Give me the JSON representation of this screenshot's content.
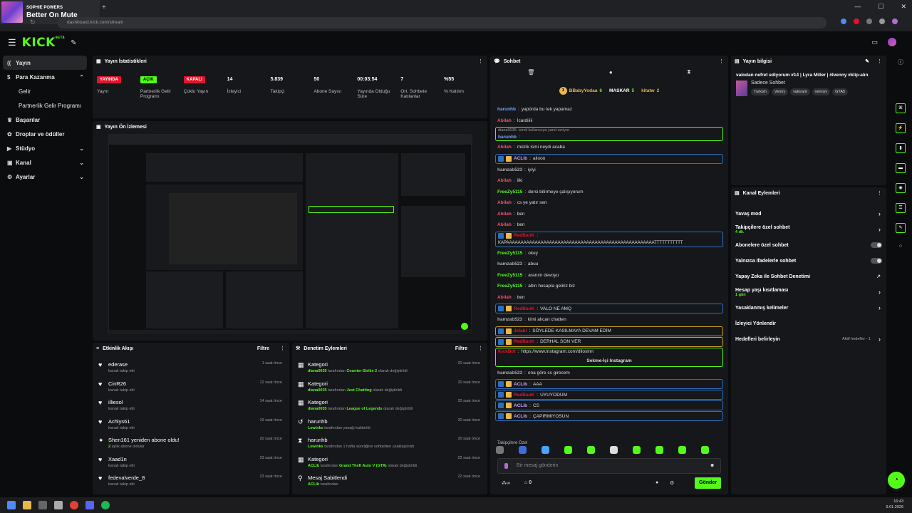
{
  "media": {
    "artist": "SOPHIE POWERS",
    "title": "Better On Mute"
  },
  "browser": {
    "url": "dashboard.kick.com/stream",
    "new_tab": "+"
  },
  "app": {
    "logo": "KICK",
    "logo_tag": "BETA"
  },
  "sidebar": {
    "items": [
      {
        "label": "Yayın",
        "icon": "broadcast-icon",
        "active": true
      },
      {
        "label": "Para Kazanma",
        "icon": "money-icon",
        "expand": "up"
      },
      {
        "label": "Gelir",
        "sub": true
      },
      {
        "label": "Partnerlik Gelir Programı",
        "sub": true
      },
      {
        "label": "Başarılar",
        "icon": "trophy-icon"
      },
      {
        "label": "Droplar ve ödüller",
        "icon": "gift-icon"
      },
      {
        "label": "Stüdyo",
        "icon": "studio-icon",
        "expand": "down"
      },
      {
        "label": "Kanal",
        "icon": "channel-icon",
        "expand": "down"
      },
      {
        "label": "Ayarlar",
        "icon": "gear-icon",
        "expand": "down"
      }
    ]
  },
  "stats": {
    "title": "Yayın İstatistikleri",
    "items": [
      {
        "value": "YAYINDA",
        "label": "Yayın",
        "badge": "red"
      },
      {
        "value": "AÇIK",
        "label": "Partnerlik Gelir Programı",
        "badge": "green"
      },
      {
        "value": "KAPALI",
        "label": "Çoklu Yayın",
        "badge": "red"
      },
      {
        "value": "14",
        "label": "İzleyici"
      },
      {
        "value": "5.839",
        "label": "Takipçi"
      },
      {
        "value": "50",
        "label": "Abone Sayısı"
      },
      {
        "value": "00:03:54",
        "label": "Yayında Olduğu Süre"
      },
      {
        "value": "7",
        "label": "Ort. Sohbete Katılanlar"
      },
      {
        "value": "%55",
        "label": "% Katılım"
      }
    ]
  },
  "preview": {
    "title": "Yayın Ön İzlemesi"
  },
  "activity": {
    "title": "Etkinlik Akışı",
    "filter": "Filtre",
    "items": [
      {
        "name": "ederase",
        "sub": "kanalı takip etti",
        "time": "1 saat önce",
        "icon": "heart-icon"
      },
      {
        "name": "CinR26",
        "sub": "kanalı takip etti",
        "time": "12 saat önce",
        "icon": "heart-icon"
      },
      {
        "name": "illiesol",
        "sub": "kanalı takip etti",
        "time": "14 saat önce",
        "icon": "heart-icon"
      },
      {
        "name": "Achlys61",
        "sub": "kanalı takip etti",
        "time": "19 saat önce",
        "icon": "heart-icon"
      },
      {
        "name": "Shen161 yeniden abone oldu!",
        "sub_highlight": "2",
        "sub": " aylık abone oldular",
        "time": "20 saat önce",
        "icon": "star-icon"
      },
      {
        "name": "Xaad1n",
        "sub": "kanalı takip etti",
        "time": "23 saat önce",
        "icon": "heart-icon"
      },
      {
        "name": "fedevalverde_8",
        "sub": "kanalı takip etti",
        "time": "23 saat önce",
        "icon": "heart-icon"
      }
    ]
  },
  "moderation": {
    "title": "Denetim Eylemleri",
    "filter": "Filtre",
    "items": [
      {
        "name": "Kategori",
        "user": "diana0035",
        "mid": " tarafından ",
        "target": "Counter-Strike 2",
        "rest": " olarak değiştirildi",
        "time": "20 saat önce",
        "icon": "category-icon"
      },
      {
        "name": "Kategori",
        "user": "diana0035",
        "mid": " tarafından ",
        "target": "Just Chatting",
        "rest": " olarak değiştirildi",
        "time": "20 saat önce",
        "icon": "category-icon"
      },
      {
        "name": "Kategori",
        "user": "diana0035",
        "mid": " tarafından ",
        "target": "League of Legends",
        "rest": " olarak değiştirildi",
        "time": "20 saat önce",
        "icon": "category-icon"
      },
      {
        "name": "harunhb",
        "user": "Lewinks",
        "mid": " tarafından yasağı kaldırıldı",
        "target": "",
        "rest": "",
        "time": "20 saat önce",
        "icon": "undo-icon"
      },
      {
        "name": "harunhb",
        "user": "Lewinks",
        "mid": " tarafından 1 hafta süreliğine sohbetten uzaklaştırıldı",
        "target": "",
        "rest": "",
        "time": "20 saat önce",
        "icon": "timeout-icon"
      },
      {
        "name": "Kategori",
        "user": "ACLib",
        "mid": " tarafından ",
        "target": "Grand Theft Auto V (GTA)",
        "rest": " olarak değiştirildi",
        "time": "22 saat önce",
        "icon": "category-icon"
      },
      {
        "name": "Mesaj Sabitlendi",
        "user": "ACLib",
        "mid": " tarafından",
        "target": "",
        "rest": "",
        "time": "22 saat önce",
        "icon": "pin-icon"
      }
    ]
  },
  "chat": {
    "title": "Sohbet",
    "leader": [
      {
        "rank": "1",
        "name": "BBabyYodaa",
        "count": "6"
      },
      {
        "name": "MASKAR",
        "count": "5"
      },
      {
        "name": "kitatw",
        "count": "2"
      }
    ],
    "messages": [
      {
        "user": "harunhb",
        "color": "#6fa8ff",
        "text": "yapürda bu tek yapamaz"
      },
      {
        "user": "Abilah",
        "color": "#ff4d6d",
        "text": "İcardiiiii"
      },
      {
        "user": "harunhb",
        "color": "#6fa8ff",
        "text": "",
        "reply": "diana0035:  isimli kullanıcıya yanıt veriyor",
        "hl": "green"
      },
      {
        "user": "Abilah",
        "color": "#ff4d6d",
        "text": "müzik ismi neydi acaba"
      },
      {
        "user": "ACLib",
        "color": "#c6a0ff",
        "text": "aliooo",
        "hl": "blue"
      },
      {
        "user": "hamzab523",
        "color": "#aaa",
        "text": "iyiyi"
      },
      {
        "user": "Abilah",
        "color": "#ff4d6d",
        "text": "iiki"
      },
      {
        "user": "FreeZy5115",
        "color": "#53fc18",
        "text": "dersi bitirmeye çalışıyorum"
      },
      {
        "user": "Abilah",
        "color": "#ff4d6d",
        "text": "cs ye yatır sen"
      },
      {
        "user": "Abilah",
        "color": "#ff4d6d",
        "text": "ben"
      },
      {
        "user": "Abilah",
        "color": "#ff4d6d",
        "text": "ben"
      },
      {
        "user": "RedBanK",
        "color": "#e0142b",
        "text": "KAPAAAAAAAAAAAAAAAAAAAAAAAAAAAAAAAAAAAAAAAAAAAAAAAAAAAATTTTTTTTTTT",
        "hl": "blue",
        "tall": true
      },
      {
        "user": "FreeZy5115",
        "color": "#53fc18",
        "text": "okey"
      },
      {
        "user": "hamzab523",
        "color": "#aaa",
        "text": "abuu"
      },
      {
        "user": "FreeZy5115",
        "color": "#53fc18",
        "text": "aranım devoyu"
      },
      {
        "user": "FreeZy5115",
        "color": "#53fc18",
        "text": "altın hesapla geliriz biz"
      },
      {
        "user": "Abilah",
        "color": "#ff4d6d",
        "text": "ben"
      },
      {
        "user": "RedBanK",
        "color": "#e0142b",
        "text": "VALO NE AMQ",
        "hl": "blue"
      },
      {
        "user": "hamzab523",
        "color": "#aaa",
        "text": "kimi alıcan chatten"
      },
      {
        "user": "Jelabi",
        "color": "#e0142b",
        "text": "SÖYLEDE KASILMAYA DEVAM EDİM",
        "hl": "gold"
      },
      {
        "user": "RedBanK",
        "color": "#e0142b",
        "text": "DERHAL SON VER",
        "hl": "gold"
      },
      {
        "user": "KickBot",
        "color": "#e0142b",
        "text": "https://www.instagram.com/dilosinn",
        "hl": "green",
        "button": "Sekme-İçi Instagram"
      },
      {
        "user": "hamzab523",
        "color": "#aaa",
        "text": "ona göre cs girecem"
      },
      {
        "user": "ACLib",
        "color": "#c6a0ff",
        "text": "AAA",
        "hl": "blue"
      },
      {
        "user": "RedBanK",
        "color": "#e0142b",
        "text": "UYUYODUM",
        "hl": "blue"
      },
      {
        "user": "ACLib",
        "color": "#c6a0ff",
        "text": "CS",
        "hl": "blue"
      },
      {
        "user": "ACLib",
        "color": "#c6a0ff",
        "text": "ÇAPIRMIYOSUN",
        "hl": "blue"
      }
    ],
    "followers_only": "Takipçilere Özel",
    "placeholder": "Bir mesaj gönderin",
    "send": "Gönder",
    "count": "0"
  },
  "info": {
    "title": "Yayın bilgisi",
    "stream_title": "valodan nefret ediyorum #14 | Lyra Miller | #Ivenny #klip-alın",
    "category": "Sadece Sohbet",
    "tags": [
      "Turkish",
      "Venny",
      "valorant",
      "vennyv",
      "GTA5"
    ]
  },
  "channel_actions": {
    "title": "Kanal Eylemleri",
    "items": [
      {
        "label": "Yavaş mod",
        "control": "chevron"
      },
      {
        "label": "Takipçilere özel sohbet",
        "sub": "4 dk.",
        "control": "chevron"
      },
      {
        "label": "Abonelere özel sohbet",
        "control": "toggle"
      },
      {
        "label": "Yalnızca ifadelerle sohbet",
        "control": "toggle"
      },
      {
        "label": "Yapay Zeka ile Sohbet Denetimi",
        "control": "external"
      },
      {
        "label": "Hesap yaşı kısıtlaması",
        "sub": "1 gün",
        "control": "chevron"
      },
      {
        "label": "Yasaklanmış kelimeler",
        "control": "chevron"
      },
      {
        "label": "İzleyici Yönlendir",
        "control": "none"
      },
      {
        "label": "Hedefleri belirleyin",
        "status": "Aktif hedefler - 1",
        "control": "chevron"
      }
    ]
  },
  "taskbar": {
    "time": "16:43",
    "date": "9.01.2026"
  },
  "colors": {
    "accent": "#53fc18",
    "live": "#e0142b",
    "bg": "#0b0c0e",
    "panel": "#16171a"
  }
}
